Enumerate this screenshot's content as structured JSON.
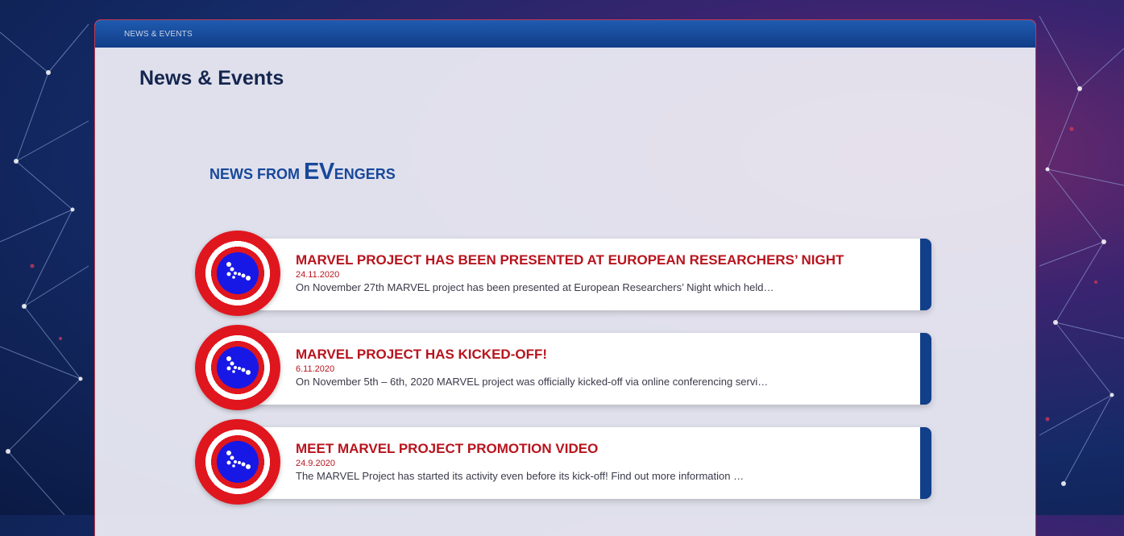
{
  "breadcrumb": "NEWS & EVENTS",
  "page_title": "News & Events",
  "section_heading": {
    "prefix": "NEWS FROM ",
    "highlight": "EV",
    "suffix": "ENGERS"
  },
  "news": [
    {
      "title": "MARVEL PROJECT HAS BEEN PRESENTED AT EUROPEAN RESEARCHERS’ NIGHT",
      "date": "24.11.2020",
      "excerpt": "On November 27th MARVEL project has been presented at European Researchers’ Night which held…"
    },
    {
      "title": "MARVEL PROJECT HAS KICKED-OFF!",
      "date": "6.11.2020",
      "excerpt": "On November 5th – 6th, 2020 MARVEL project was officially kicked-off via online conferencing servi…"
    },
    {
      "title": "MEET MARVEL PROJECT PROMOTION VIDEO",
      "date": "24.9.2020",
      "excerpt": "The MARVEL Project has started its activity even before its kick-off! Find out more information …"
    }
  ],
  "colors": {
    "accent": "#b8141e",
    "navy": "#123f8a",
    "shield_red": "#e0161e",
    "shield_blue": "#1818e6"
  },
  "icons": {
    "news_icon": "marvel-shield-icon"
  }
}
